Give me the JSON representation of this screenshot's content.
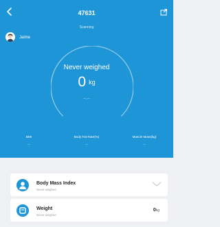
{
  "header": {
    "device_id": "47631",
    "status": "Scanning",
    "back_icon": "chevron-left-icon",
    "export_icon": "export-icon"
  },
  "user": {
    "name": "Jaime",
    "avatar_icon": "avatar-icon"
  },
  "gauge": {
    "message": "Never weighed",
    "value": "0",
    "unit": "kg",
    "secondary": "--.--"
  },
  "metrics": [
    {
      "label": "BMI",
      "value": "--"
    },
    {
      "label": "Body Fat Rate(%)",
      "value": "--"
    },
    {
      "label": "Muscle Mass(kg)",
      "value": "--"
    }
  ],
  "cards": [
    {
      "title": "Body Mass Index",
      "subtitle": "Never weighed",
      "icon": "person-icon",
      "action_icon": "chevron-down-icon"
    },
    {
      "title": "Weight",
      "subtitle": "Never weighed",
      "icon": "scale-icon",
      "value": "0",
      "unit": "kg"
    }
  ],
  "colors": {
    "primary": "#1e95d6",
    "background": "#eef0f3",
    "card": "#ffffff"
  }
}
